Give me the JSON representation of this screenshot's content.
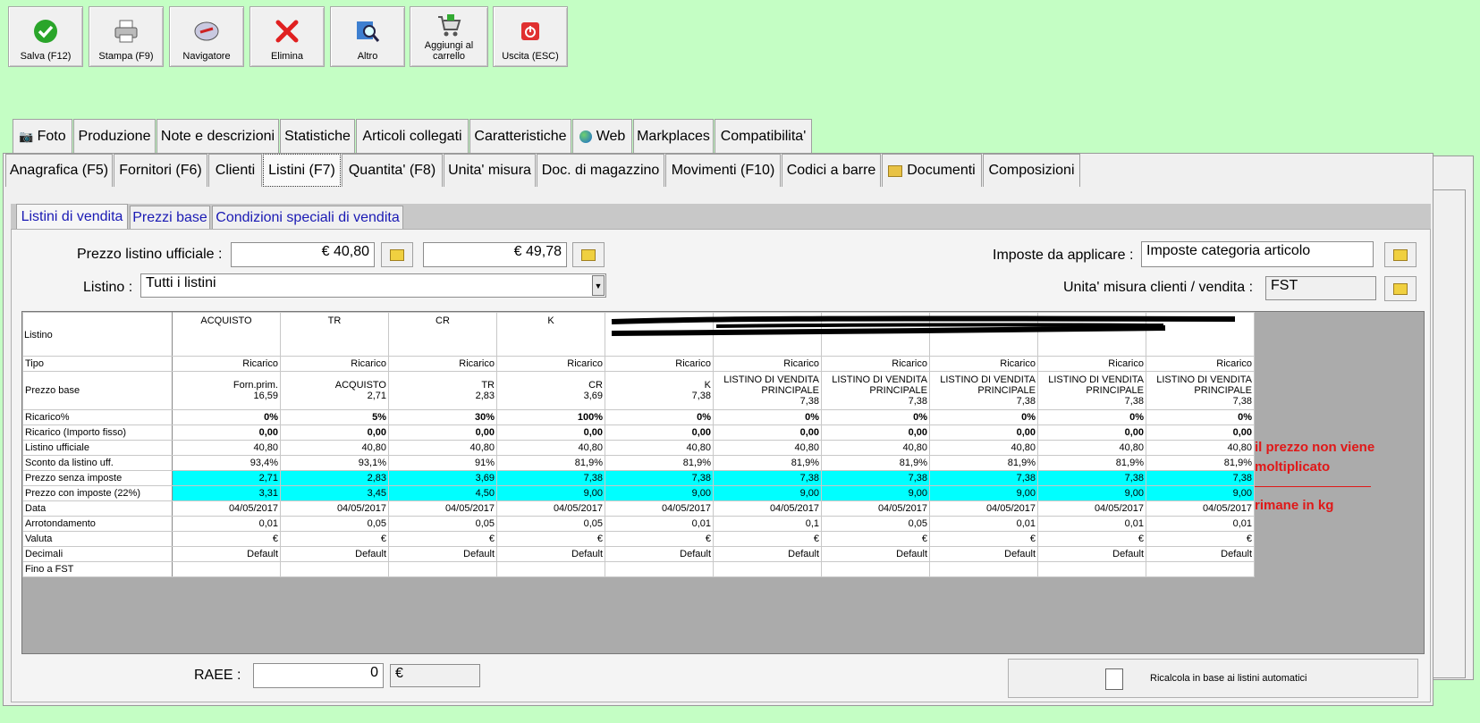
{
  "toolbar": {
    "buttons": [
      {
        "label": "Salva (F12)",
        "icon": "check-icon"
      },
      {
        "label": "Stampa (F9)",
        "icon": "printer-icon"
      },
      {
        "label": "Navigatore",
        "icon": "compass-icon"
      },
      {
        "label": "Elimina",
        "icon": "delete-x-icon"
      },
      {
        "label": "Altro",
        "icon": "magnifier-icon"
      },
      {
        "label": "Aggiungi al carrello",
        "icon": "cart-icon"
      },
      {
        "label": "Uscita (ESC)",
        "icon": "power-icon"
      }
    ]
  },
  "tabs_row1": [
    "Foto",
    "Produzione",
    "Note e descrizioni",
    "Statistiche",
    "Articoli collegati",
    "Caratteristiche",
    "Web",
    "Markplaces",
    "Compatibilita'"
  ],
  "tabs_row2": [
    "Anagrafica (F5)",
    "Fornitori (F6)",
    "Clienti",
    "Listini (F7)",
    "Quantita' (F8)",
    "Unita' misura",
    "Doc. di magazzino",
    "Movimenti (F10)",
    "Codici a barre",
    "Documenti",
    "Composizioni"
  ],
  "subtabs": [
    "Listini di vendita",
    "Prezzi base",
    "Condizioni speciali di vendita"
  ],
  "form": {
    "prezzo_label": "Prezzo listino ufficiale :",
    "prezzo1": "€ 40,80",
    "prezzo2": "€ 49,78",
    "listino_label": "Listino :",
    "listino_value": "Tutti i listini",
    "imposte_label": "Imposte da applicare :",
    "imposte_value": "Imposte categoria articolo",
    "unita_label": "Unita' misura clienti / vendita :",
    "unita_value": "FST",
    "raee_label": "RAEE :",
    "raee_value": "0",
    "raee_currency": "€",
    "ricalcola_label": "Ricalcola in base ai listini automatici"
  },
  "grid": {
    "header_label": "Listino",
    "columns": [
      "ACQUISTO",
      "TR",
      "CR",
      "K",
      "",
      "",
      "",
      "",
      "",
      ""
    ],
    "rows": [
      {
        "label": "Tipo",
        "values": [
          "Ricarico",
          "Ricarico",
          "Ricarico",
          "Ricarico",
          "Ricarico",
          "Ricarico",
          "Ricarico",
          "Ricarico",
          "Ricarico",
          "Ricarico"
        ]
      },
      {
        "label": "Prezzo base",
        "multi": true,
        "values": [
          [
            "Forn.prim.",
            "16,59"
          ],
          [
            "ACQUISTO",
            "2,71"
          ],
          [
            "TR",
            "2,83"
          ],
          [
            "CR",
            "3,69"
          ],
          [
            "K",
            "7,38"
          ],
          [
            "LISTINO DI VENDITA",
            "PRINCIPALE",
            "7,38"
          ],
          [
            "LISTINO DI VENDITA",
            "PRINCIPALE",
            "7,38"
          ],
          [
            "LISTINO DI VENDITA",
            "PRINCIPALE",
            "7,38"
          ],
          [
            "LISTINO DI VENDITA",
            "PRINCIPALE",
            "7,38"
          ],
          [
            "LISTINO DI VENDITA",
            "PRINCIPALE",
            "7,38"
          ]
        ]
      },
      {
        "label": "Ricarico%",
        "bold": true,
        "values": [
          "0%",
          "5%",
          "30%",
          "100%",
          "0%",
          "0%",
          "0%",
          "0%",
          "0%",
          "0%"
        ]
      },
      {
        "label": "Ricarico (Importo fisso)",
        "bold": true,
        "values": [
          "0,00",
          "0,00",
          "0,00",
          "0,00",
          "0,00",
          "0,00",
          "0,00",
          "0,00",
          "0,00",
          "0,00"
        ]
      },
      {
        "label": "Listino ufficiale",
        "values": [
          "40,80",
          "40,80",
          "40,80",
          "40,80",
          "40,80",
          "40,80",
          "40,80",
          "40,80",
          "40,80",
          "40,80"
        ]
      },
      {
        "label": "Sconto da listino uff.",
        "values": [
          "93,4%",
          "93,1%",
          "91%",
          "81,9%",
          "81,9%",
          "81,9%",
          "81,9%",
          "81,9%",
          "81,9%",
          "81,9%"
        ]
      },
      {
        "label": "Prezzo senza imposte",
        "cyan": true,
        "values": [
          "2,71",
          "2,83",
          "3,69",
          "7,38",
          "7,38",
          "7,38",
          "7,38",
          "7,38",
          "7,38",
          "7,38"
        ]
      },
      {
        "label": "Prezzo con imposte (22%)",
        "cyan": true,
        "values": [
          "3,31",
          "3,45",
          "4,50",
          "9,00",
          "9,00",
          "9,00",
          "9,00",
          "9,00",
          "9,00",
          "9,00"
        ]
      },
      {
        "label": "Data",
        "values": [
          "04/05/2017",
          "04/05/2017",
          "04/05/2017",
          "04/05/2017",
          "04/05/2017",
          "04/05/2017",
          "04/05/2017",
          "04/05/2017",
          "04/05/2017",
          "04/05/2017"
        ]
      },
      {
        "label": "Arrotondamento",
        "values": [
          "0,01",
          "0,05",
          "0,05",
          "0,05",
          "0,01",
          "0,1",
          "0,05",
          "0,01",
          "0,01",
          "0,01"
        ]
      },
      {
        "label": "Valuta",
        "values": [
          "€",
          "€",
          "€",
          "€",
          "€",
          "€",
          "€",
          "€",
          "€",
          "€"
        ]
      },
      {
        "label": "Decimali",
        "values": [
          "Default",
          "Default",
          "Default",
          "Default",
          "Default",
          "Default",
          "Default",
          "Default",
          "Default",
          "Default"
        ]
      },
      {
        "label": "Fino a FST",
        "values": [
          "",
          "",
          "",
          "",
          "",
          "",
          "",
          "",
          "",
          ""
        ]
      }
    ]
  },
  "notes": [
    "il prezzo non viene moltiplicato",
    "rimane in kg"
  ],
  "colors": {
    "background": "#c4fec4",
    "cyan_row": "#00ffff",
    "note_red": "#e01818",
    "link_blue": "#1a1ab4"
  }
}
